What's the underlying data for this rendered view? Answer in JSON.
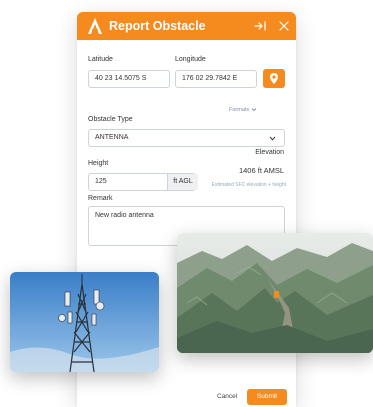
{
  "header": {
    "title": "Report Obstacle",
    "icons": {
      "logo": "app-logo-icon",
      "collapse": "collapse-right-icon",
      "close": "close-icon"
    }
  },
  "location": {
    "latitude_label": "Latitude",
    "latitude_value": "40 23 14.5075 S",
    "longitude_label": "Longitude",
    "longitude_value": "176 02 29.7842 E",
    "pin_icon": "map-pin-icon",
    "formats_label": "Formats"
  },
  "obstacle_type": {
    "label": "Obstacle Type",
    "selected": "ANTENNA"
  },
  "height": {
    "label": "Height",
    "value": "125",
    "unit": "ft AGL"
  },
  "elevation": {
    "label": "Elevation",
    "value": "1406  ft AMSL",
    "note": "Estimated SFC elevation + height"
  },
  "remark": {
    "label": "Remark",
    "value": "New radio antenna"
  },
  "footer": {
    "cancel_label": "Cancel",
    "submit_label": "Submit"
  },
  "colors": {
    "accent": "#f58a1f",
    "border": "#cfd4d9",
    "muted": "#7b8fa3"
  }
}
